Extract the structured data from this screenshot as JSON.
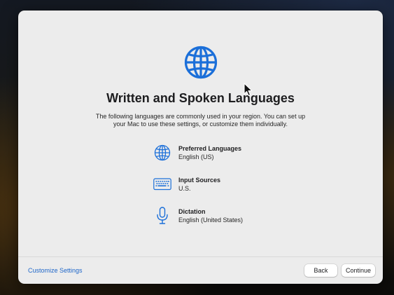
{
  "title": "Written and Spoken Languages",
  "description": "The following languages are commonly used in your region. You can set up your Mac to use these settings, or customize them individually.",
  "items": [
    {
      "name": "Preferred Languages",
      "value": "English (US)",
      "icon": "globe-icon"
    },
    {
      "name": "Input Sources",
      "value": "U.S.",
      "icon": "keyboard-icon"
    },
    {
      "name": "Dictation",
      "value": "English (United States)",
      "icon": "microphone-icon"
    }
  ],
  "footer": {
    "customize_label": "Customize Settings",
    "back_label": "Back",
    "continue_label": "Continue"
  },
  "colors": {
    "accent": "#1f67c9",
    "icon_blue": "#1b6fd9",
    "window_bg": "#ececec"
  }
}
